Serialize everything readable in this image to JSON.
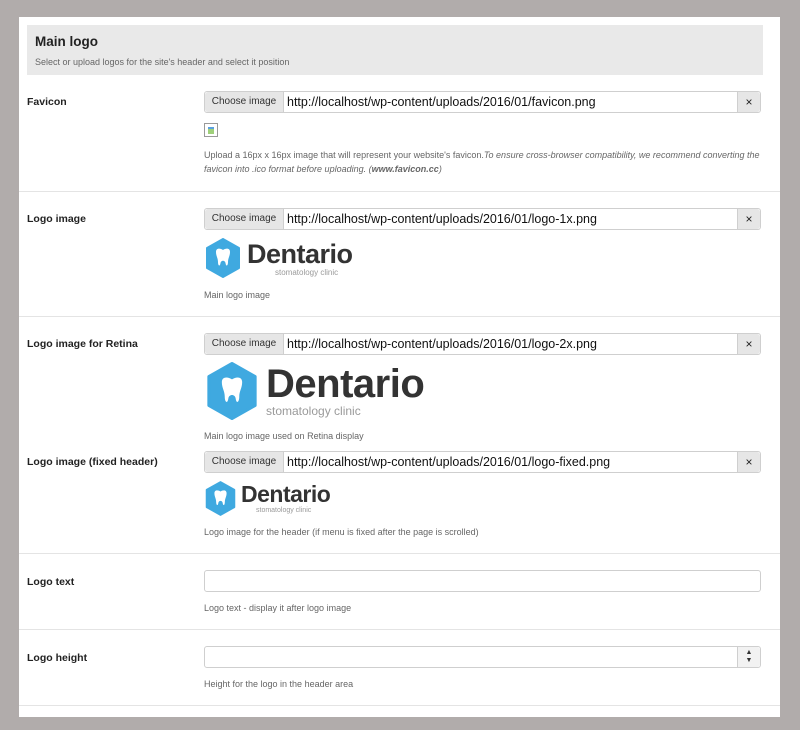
{
  "section": {
    "title": "Main logo",
    "description": "Select or upload logos for the site's header and select it position"
  },
  "colors": {
    "background": "#b1acab",
    "header_bg": "#e9e9e9",
    "logo_blue": "#3fa9e0"
  },
  "fields": {
    "favicon": {
      "label": "Favicon",
      "choose_label": "Choose image",
      "url": "http://localhost/wp-content/uploads/2016/01/favicon.png",
      "clear_label": "×",
      "hint_plain": "Upload a 16px x 16px image that will represent your website's favicon.",
      "hint_italic_1": "To ensure cross-browser compatibility, we recommend converting the favicon into .ico format before uploading. (",
      "hint_bold": "www.favicon.cc",
      "hint_italic_2": ")"
    },
    "logo": {
      "label": "Logo image",
      "choose_label": "Choose image",
      "url": "http://localhost/wp-content/uploads/2016/01/logo-1x.png",
      "clear_label": "×",
      "hint": "Main logo image"
    },
    "logo_retina": {
      "label": "Logo image for Retina",
      "choose_label": "Choose image",
      "url": "http://localhost/wp-content/uploads/2016/01/logo-2x.png",
      "clear_label": "×",
      "hint": "Main logo image used on Retina display"
    },
    "logo_fixed": {
      "label": "Logo image (fixed header)",
      "choose_label": "Choose image",
      "url": "http://localhost/wp-content/uploads/2016/01/logo-fixed.png",
      "clear_label": "×",
      "hint": "Logo image for the header (if menu is fixed after the page is scrolled)"
    },
    "logo_text": {
      "label": "Logo text",
      "value": "",
      "hint": "Logo text - display it after logo image"
    },
    "logo_height": {
      "label": "Logo height",
      "value": "",
      "spinner_up": "▲",
      "spinner_down": "▼",
      "hint": "Height for the logo in the header area"
    }
  },
  "brand": {
    "name": "Dentario",
    "tagline": "stomatology clinic",
    "icon": "tooth-icon"
  }
}
